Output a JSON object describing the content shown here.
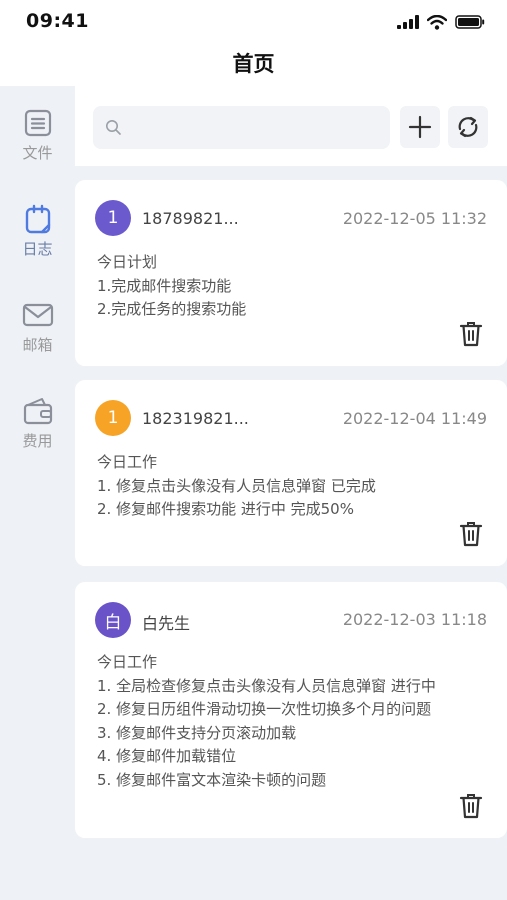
{
  "status_bar": {
    "time": "09:41"
  },
  "header": {
    "title": "首页"
  },
  "sidebar": {
    "items": [
      {
        "label": "文件",
        "icon": "document-icon",
        "active": false
      },
      {
        "label": "日志",
        "icon": "notebook-icon",
        "active": true
      },
      {
        "label": "邮箱",
        "icon": "mail-icon",
        "active": false
      },
      {
        "label": "费用",
        "icon": "wallet-icon",
        "active": false
      }
    ]
  },
  "toolbar": {
    "search_placeholder": "",
    "search_value": "",
    "add_icon": "plus-icon",
    "refresh_icon": "refresh-icon"
  },
  "logs": [
    {
      "avatar_text": "1",
      "avatar_color": "#6a5acd",
      "name": "18789821...",
      "time": "2022-12-05 11:32",
      "lines": [
        "今日计划",
        "1.完成邮件搜索功能",
        "2.完成任务的搜索功能"
      ]
    },
    {
      "avatar_text": "1",
      "avatar_color": "#f7a326",
      "name": "182319821...",
      "time": "2022-12-04 11:49",
      "lines": [
        "今日工作",
        "1. 修复点击头像没有人员信息弹窗 已完成",
        "2. 修复邮件搜索功能 进行中 完成50%"
      ]
    },
    {
      "avatar_text": "白",
      "avatar_color": "#6a52c9",
      "name": "白先生",
      "time": "2022-12-03 11:18",
      "lines": [
        "今日工作",
        "1. 全局检查修复点击头像没有人员信息弹窗 进行中",
        "2. 修复日历组件滑动切换一次性切换多个月的问题",
        "3. 修复邮件支持分页滚动加载",
        "4. 修复邮件加载错位",
        "5. 修复邮件富文本渲染卡顿的问题"
      ]
    }
  ]
}
